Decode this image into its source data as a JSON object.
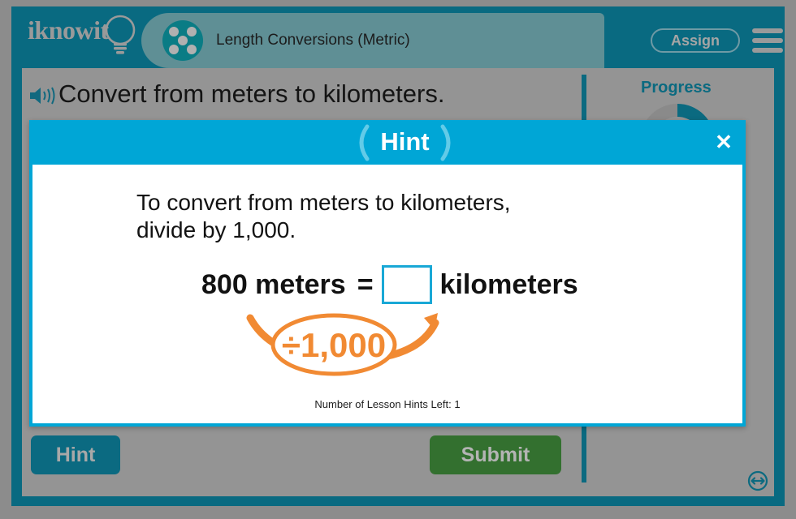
{
  "app": {
    "brand": "iknowit",
    "lesson_title": "Length Conversions (Metric)",
    "assign_label": "Assign",
    "menu_icon": "hamburger-menu-icon",
    "lesson_icon": "five-dot-circle-icon"
  },
  "question": {
    "speaker_icon": "speaker-audio-icon",
    "text": "Convert from meters to kilometers."
  },
  "progress": {
    "label": "Progress",
    "percent": 25,
    "track_color": "#8a8a8a",
    "fill_color": "#0b6a80"
  },
  "actions": {
    "hint_label": "Hint",
    "submit_label": "Submit",
    "resize_icon": "resize-horizontal-icon"
  },
  "hint_dialog": {
    "title": "Hint",
    "close_icon": "close-icon",
    "line1": "To convert from meters to kilometers,",
    "line2": "divide by 1,000.",
    "equation": {
      "left": "800 meters",
      "operator": "=",
      "answer_value": "",
      "unit": "kilometers"
    },
    "annotation": "÷1,000",
    "hints_left_text": "Number of Lesson Hints Left: 1"
  },
  "colors": {
    "page_background": "#8c8c8c",
    "frame_teal": "#096a81",
    "panel_gray": "#949494",
    "tab_teal": "#5f8f95",
    "dialog_cyan": "#00a6d6",
    "accent_orange": "#f18a33",
    "submit_green": "#33702f",
    "input_border": "#19a8d6"
  }
}
